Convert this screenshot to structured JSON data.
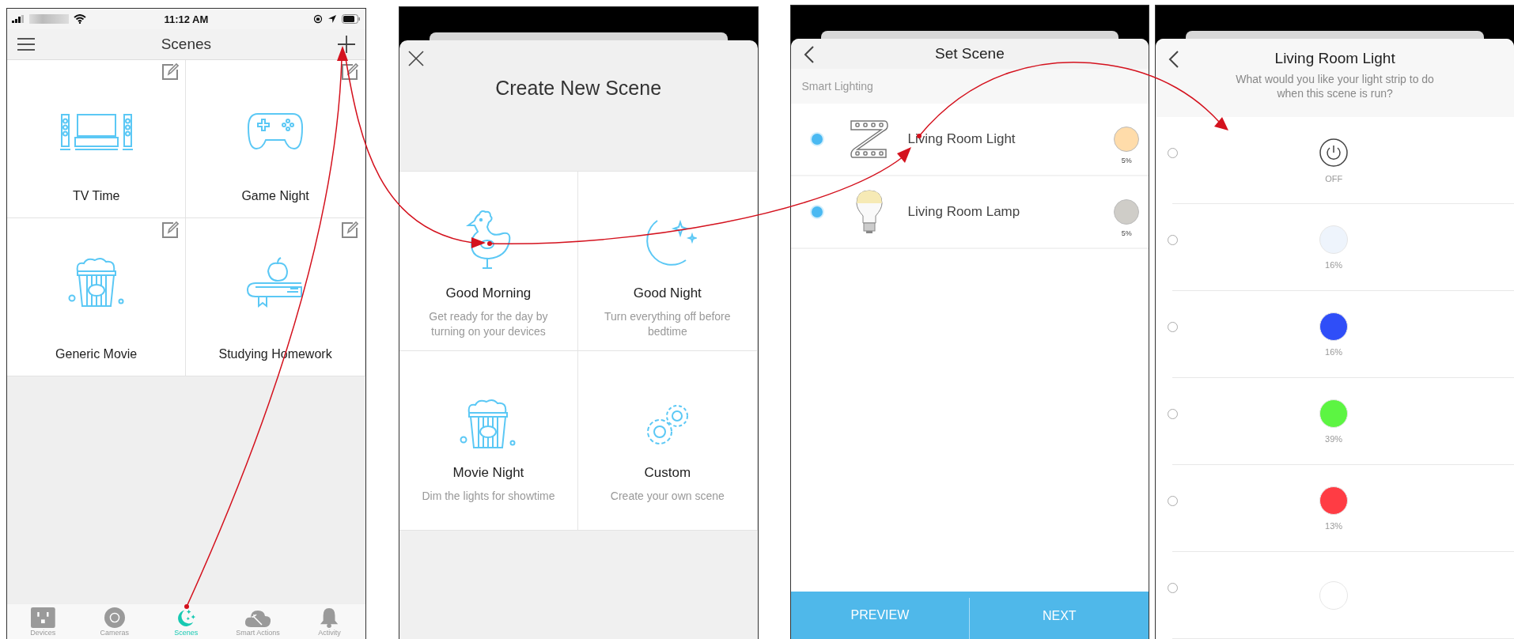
{
  "scenes_screen": {
    "status_bar": {
      "time": "11:12 AM"
    },
    "title": "Scenes",
    "scenes": [
      {
        "name": "TV Time"
      },
      {
        "name": "Game Night"
      },
      {
        "name": "Generic Movie"
      },
      {
        "name": "Studying Homework"
      }
    ],
    "tab_bar": [
      {
        "label": "Devices",
        "selected": false
      },
      {
        "label": "Cameras",
        "selected": false
      },
      {
        "label": "Scenes",
        "selected": true
      },
      {
        "label": "Smart Actions",
        "selected": false
      },
      {
        "label": "Activity",
        "selected": false
      }
    ]
  },
  "create_scene_sheet": {
    "title": "Create New Scene",
    "templates": [
      {
        "name": "Good Morning",
        "description": "Get ready for the day by turning on your devices"
      },
      {
        "name": "Good Night",
        "description": "Turn everything off before bedtime"
      },
      {
        "name": "Movie Night",
        "description": "Dim the lights for showtime"
      },
      {
        "name": "Custom",
        "description": "Create your own scene"
      }
    ]
  },
  "set_scene_sheet": {
    "title": "Set Scene",
    "section": "Smart Lighting",
    "devices": [
      {
        "name": "Living Room Light",
        "selected": true,
        "color": "#ffdcaa",
        "reading": "5%"
      },
      {
        "name": "Living Room Lamp",
        "selected": true,
        "color": "#cfcdc8",
        "reading": "5%"
      }
    ],
    "buttons": [
      "PREVIEW",
      "NEXT"
    ]
  },
  "light_strip_sheet": {
    "title": "Living Room Light",
    "subtitle": "What would you like your light strip to do when this scene is run?",
    "options": [
      {
        "kind": "off",
        "label": "OFF",
        "selected": false
      },
      {
        "kind": "color",
        "label": "16%",
        "selected": false,
        "color": "#eef4fc"
      },
      {
        "kind": "color",
        "label": "16%",
        "selected": false,
        "color": "#2f4ef8"
      },
      {
        "kind": "color",
        "label": "39%",
        "selected": false,
        "color": "#5cf542"
      },
      {
        "kind": "color",
        "label": "13%",
        "selected": false,
        "color": "#ff3c44"
      },
      {
        "kind": "color",
        "selected": false,
        "color": "#ffffff"
      }
    ]
  }
}
